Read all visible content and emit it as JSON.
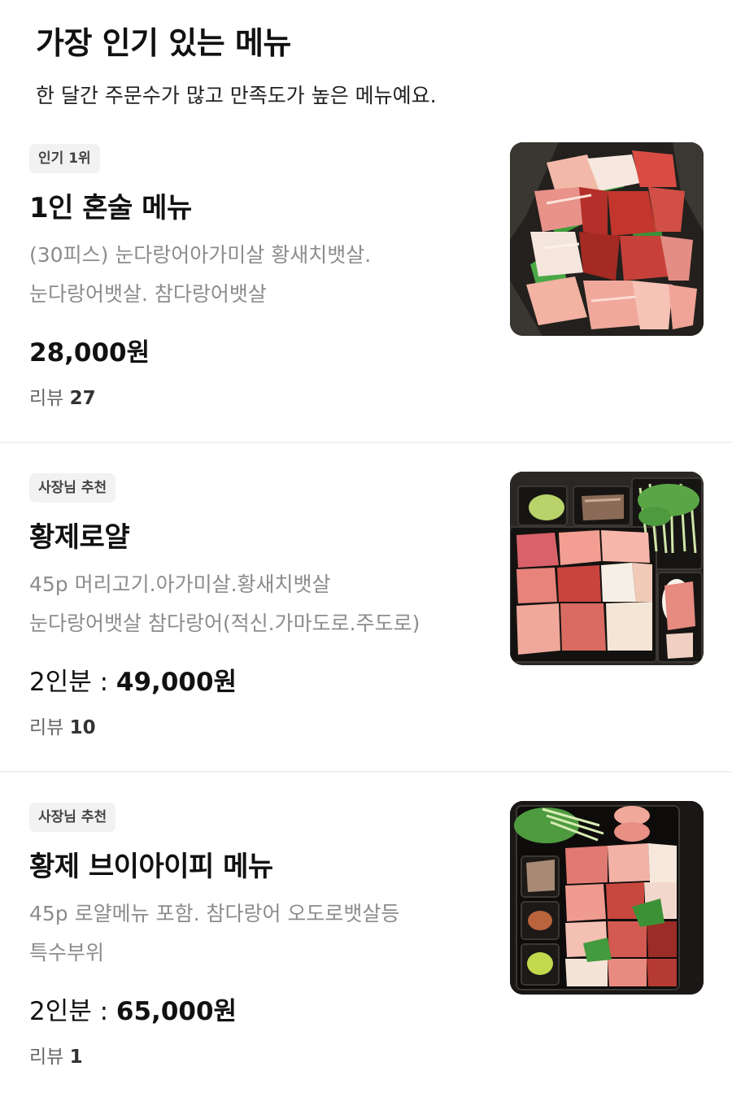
{
  "section": {
    "title": "가장 인기 있는 메뉴",
    "subtitle": "한 달간 주문수가 많고 만족도가 높은 메뉴예요."
  },
  "menus": [
    {
      "badge": "인기 1위",
      "name": "1인 혼술 메뉴",
      "description": "(30피스)    눈다랑어아가미살 황새치뱃살.\n눈다랑어뱃살. 참다랑어뱃살",
      "price_prefix": "",
      "price": "28,000원",
      "review_label": "리뷰",
      "review_count": "27",
      "photo": "sashimi-platter-photo"
    },
    {
      "badge": "사장님 추천",
      "name": "황제로얄",
      "description": "45p 머리고기.아가미살.황새치뱃살\n눈다랑어뱃살 참다랑어(적신.가마도로.주도로)",
      "price_prefix": "2인분 : ",
      "price": "49,000원",
      "review_label": "리뷰",
      "review_count": "10",
      "photo": "tuna-bento-photo"
    },
    {
      "badge": "사장님 추천",
      "name": "황제 브이아이피 메뉴",
      "description": "45p 로얄메뉴 포함.  참다랑어 오도로뱃살등\n특수부위",
      "price_prefix": "2인분 : ",
      "price": "65,000원",
      "review_label": "리뷰",
      "review_count": "1",
      "photo": "vip-bento-photo"
    }
  ],
  "colors": {
    "badge_bg": "#f2f2f2",
    "description": "#8c8c8c",
    "divider": "#f0f0f0",
    "tuna_red": "#c2362e",
    "tuna_pink": "#f0a89a",
    "leaf_green": "#3f9e3a"
  }
}
